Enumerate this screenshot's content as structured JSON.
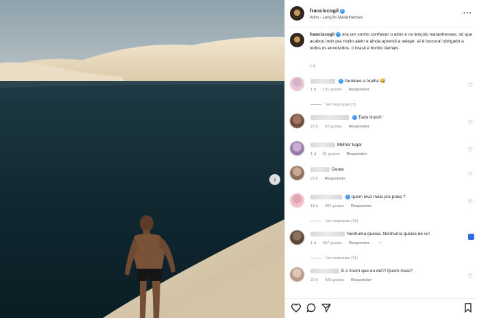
{
  "post": {
    "username": "franciscogil",
    "location": "Atins - Lençóis Maranhenses",
    "caption_text": "era um sonho conhecer o atins e os lençóis maranhenses, só que acabou indo pra muito além e ainda aprendi a velejar, aí é loucura! obrigado a todos os envolvidos. o brasil é bonito demais.",
    "caption_time": "1 d"
  },
  "icons": {
    "verified": "verified-badge-icon",
    "more": "more-options-icon",
    "heart": "heart-icon",
    "next": "chevron-right-icon",
    "comment": "comment-icon",
    "share": "share-icon",
    "save": "bookmark-icon"
  },
  "colors": {
    "verified": "#3897f0",
    "water": "#0f2830",
    "sand": "#e9dcc3"
  },
  "comments": [
    {
      "text": "Genteee a toalha 😂",
      "time": "1 d",
      "likes": "191 gostos",
      "reply": "Responder",
      "verified": true,
      "replies": "Ver respostas (3)"
    },
    {
      "text": "Tudo lindo!!!",
      "time": "23 h",
      "likes": "52 gostos",
      "reply": "Responder",
      "verified": true,
      "replies": ""
    },
    {
      "text": "Melhor lugar",
      "time": "1 d",
      "likes": "21 gostos",
      "reply": "Responder",
      "verified": false,
      "replies": ""
    },
    {
      "text": "Gente",
      "time": "23 h",
      "likes": "",
      "reply": "Responder",
      "verified": false,
      "replies": ""
    },
    {
      "text": "quem leva mala pra praia ?",
      "time": "19 h",
      "likes": "382 gostos",
      "reply": "Responder",
      "verified": true,
      "replies": "Ver respostas (19)"
    },
    {
      "text": "Nenhuma queixa. Nenhuma queixa de vc!",
      "time": "1 d",
      "likes": "557 gostos",
      "reply": "Responder",
      "verified": false,
      "replies": "Ver respostas (11)"
    },
    {
      "text": "E o zoom que eu dei?! Quem mais?",
      "time": "23 h",
      "likes": "428 gostos",
      "reply": "Responder",
      "verified": false,
      "replies": ""
    }
  ]
}
